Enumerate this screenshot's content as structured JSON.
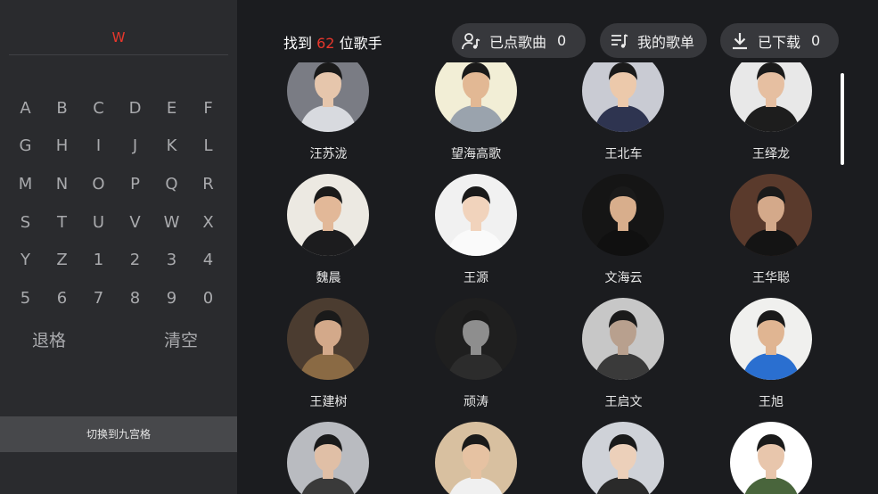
{
  "search": {
    "query": "W"
  },
  "keyboard": {
    "keys": [
      "A",
      "B",
      "C",
      "D",
      "E",
      "F",
      "G",
      "H",
      "I",
      "J",
      "K",
      "L",
      "M",
      "N",
      "O",
      "P",
      "Q",
      "R",
      "S",
      "T",
      "U",
      "V",
      "W",
      "X",
      "Y",
      "Z",
      "1",
      "2",
      "3",
      "4",
      "5",
      "6",
      "7",
      "8",
      "9",
      "0"
    ],
    "backspace_label": "退格",
    "clear_label": "清空",
    "switch_label": "切换到九宫格"
  },
  "header": {
    "found_prefix": "找到",
    "found_count": "62",
    "found_suffix": "位歌手",
    "played_label": "已点歌曲",
    "played_count": "0",
    "playlist_label": "我的歌单",
    "downloaded_label": "已下载",
    "downloaded_count": "0"
  },
  "singers": [
    [
      {
        "name": "汪苏泷",
        "tone": "#7a7c84",
        "skin": "#e6c6ac",
        "cloth": "#d8dadf"
      },
      {
        "name": "望海高歌",
        "tone": "#f2eed6",
        "skin": "#e2b894",
        "cloth": "#9aa3ad"
      },
      {
        "name": "王北车",
        "tone": "#c9cbd3",
        "skin": "#ecc9ab",
        "cloth": "#2e3450"
      },
      {
        "name": "王绎龙",
        "tone": "#e8e8e8",
        "skin": "#e6bfa1",
        "cloth": "#1d1d1d"
      }
    ],
    [
      {
        "name": "魏晨",
        "tone": "#ece9e2",
        "skin": "#e2b898",
        "cloth": "#1c1c1e"
      },
      {
        "name": "王源",
        "tone": "#f1f1f1",
        "skin": "#f1d3bc",
        "cloth": "#fafafa"
      },
      {
        "name": "文海云",
        "tone": "#151515",
        "skin": "#d8ae8c",
        "cloth": "#101010"
      },
      {
        "name": "王华聪",
        "tone": "#5a3a2c",
        "skin": "#d4a98a",
        "cloth": "#141414"
      }
    ],
    [
      {
        "name": "王建树",
        "tone": "#4b3c30",
        "skin": "#d3a98a",
        "cloth": "#8a6a44"
      },
      {
        "name": "顽涛",
        "tone": "#1f1f1f",
        "skin": "#8e8e8e",
        "cloth": "#2c2c2c"
      },
      {
        "name": "王启文",
        "tone": "#c7c7c7",
        "skin": "#b8a08e",
        "cloth": "#3a3a3a"
      },
      {
        "name": "王旭",
        "tone": "#f0f0ee",
        "skin": "#e0b592",
        "cloth": "#2a6fd0"
      }
    ],
    [
      {
        "name": "",
        "tone": "#b9bbc0",
        "skin": "#e0bfa6",
        "cloth": "#3a3a3a"
      },
      {
        "name": "",
        "tone": "#d8c0a0",
        "skin": "#e6c2a2",
        "cloth": "#f0f0f0"
      },
      {
        "name": "",
        "tone": "#cfd2d8",
        "skin": "#ecd0ba",
        "cloth": "#2a2a2a"
      },
      {
        "name": "",
        "tone": "#ffffff",
        "skin": "#e8c6ac",
        "cloth": "#49653c"
      }
    ]
  ],
  "colors": {
    "accent": "#e8372c",
    "panel": "#2a2b2e",
    "background": "#1b1c1f",
    "pill": "#37383c"
  },
  "icons": {
    "played": "person-music-icon",
    "playlist": "playlist-icon",
    "downloaded": "download-icon"
  }
}
